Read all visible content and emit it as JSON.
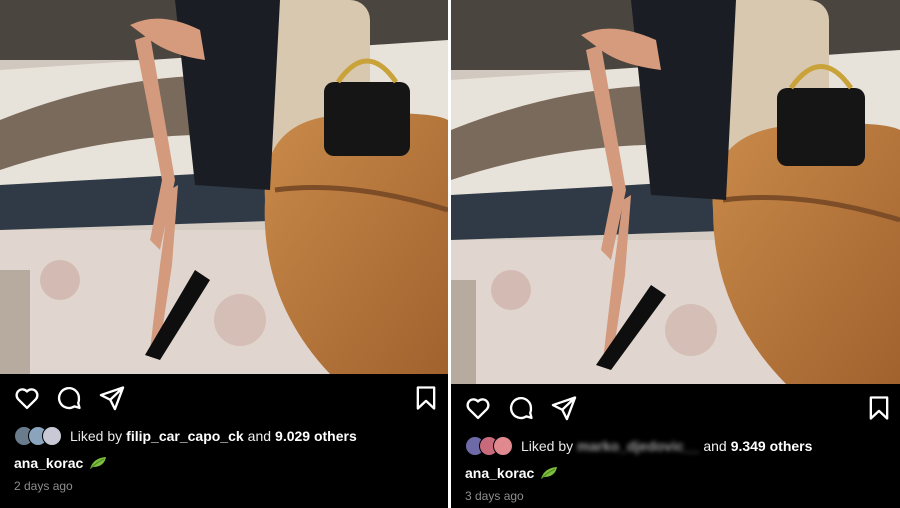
{
  "colors": {
    "background": "#000000",
    "text": "#ffffff",
    "muted": "#8e8e8e"
  },
  "posts": [
    {
      "icons": [
        "heart-icon",
        "comment-icon",
        "share-icon",
        "bookmark-icon"
      ],
      "likes": {
        "prefix": "Liked by",
        "liker": "filip_car_capo_ck",
        "joiner": "and",
        "count": "9.029 others"
      },
      "username": "ana_korac",
      "emoji": "leaf-emoji",
      "timestamp": "2 days ago"
    },
    {
      "icons": [
        "heart-icon",
        "comment-icon",
        "share-icon",
        "bookmark-icon"
      ],
      "likes": {
        "prefix": "Liked by",
        "liker": "marko_djedovic__",
        "joiner": "and",
        "count": "9.349 others"
      },
      "username": "ana_korac",
      "emoji": "leaf-emoji",
      "timestamp": "3 days ago"
    }
  ]
}
